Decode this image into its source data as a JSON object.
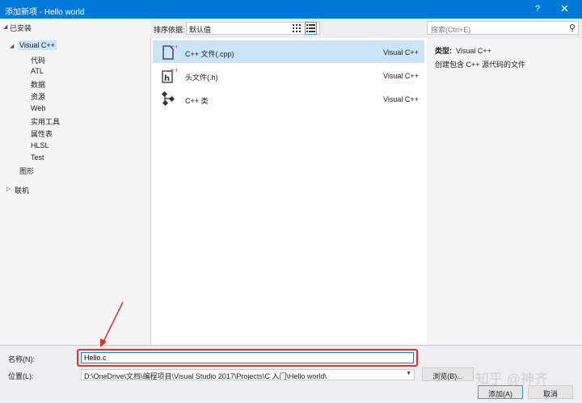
{
  "window": {
    "title": "添加新项 - Hello world",
    "help": "?",
    "close": "✕"
  },
  "tree": {
    "installed": "已安装",
    "visual_cpp": "Visual C++",
    "children": [
      "代码",
      "ATL",
      "数据",
      "资源",
      "Web",
      "实用工具",
      "属性表",
      "HLSL",
      "Test"
    ],
    "graphics": "图形",
    "online": "联机"
  },
  "toolbar": {
    "sort_label": "排序依据:",
    "sort_value": "默认值"
  },
  "search": {
    "placeholder": "搜索(Ctrl+E)"
  },
  "templates": [
    {
      "name": "C++ 文件(.cpp)",
      "type": "Visual C++",
      "icon": "cpp-file-icon"
    },
    {
      "name": "头文件(.h)",
      "type": "Visual C++",
      "icon": "header-file-icon"
    },
    {
      "name": "C++ 类",
      "type": "Visual C++",
      "icon": "cpp-class-icon"
    }
  ],
  "details": {
    "type_label": "类型:",
    "type_value": "Visual C++",
    "description": "创建包含 C++ 源代码的文件"
  },
  "form": {
    "name_label": "名称(N):",
    "name_value": "Hello.c",
    "location_label": "位置(L):",
    "location_value": "D:\\OneDrive\\文档\\编程项目\\Visual Studio 2017\\Projects\\C 入门\\Hello world\\",
    "browse": "浏览(B)...",
    "add": "添加(A)",
    "cancel": "取消"
  },
  "watermark": "知乎 @神齐",
  "colors": {
    "accent": "#0078d7",
    "selection": "#cce4f7",
    "highlight": "#e03030"
  }
}
